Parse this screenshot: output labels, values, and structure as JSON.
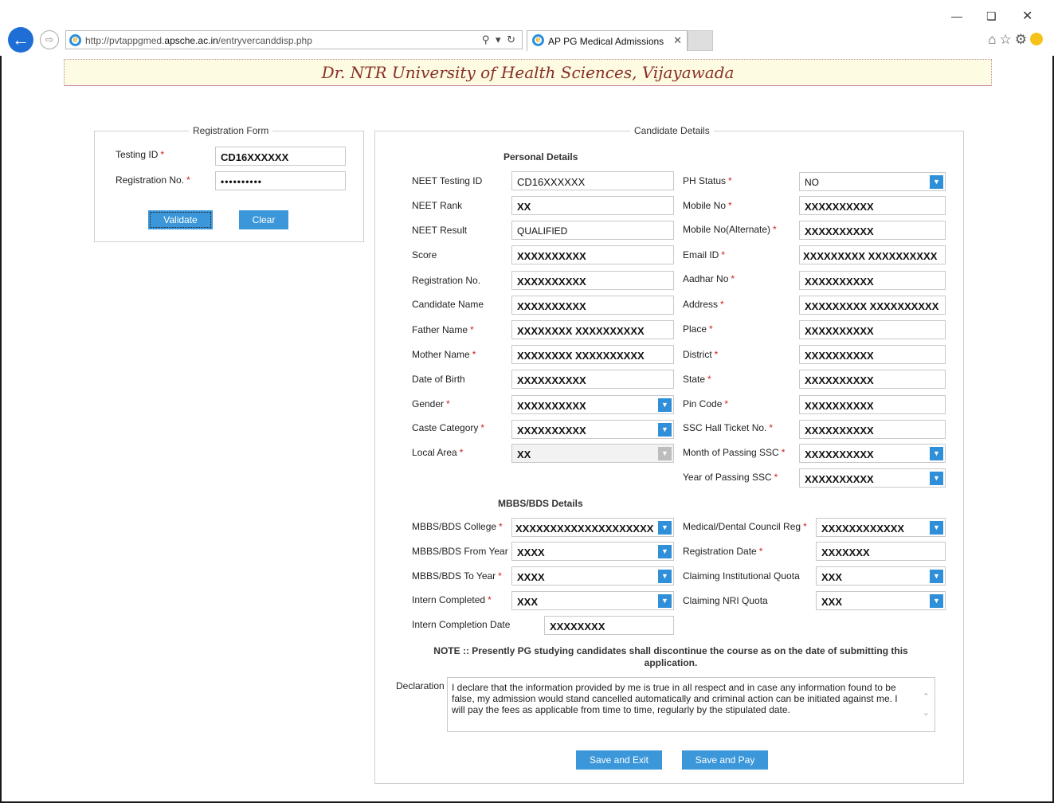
{
  "browser": {
    "url_prefix": "http://pvtappgmed.",
    "url_domain": "apsche.ac.in",
    "url_path": "/entryvercanddisp.php",
    "tab_title": "AP PG Medical Admissions"
  },
  "page": {
    "banner": "Dr. NTR University of Health Sciences, Vijayawada"
  },
  "registration": {
    "legend": "Registration Form",
    "testing_id_label": "Testing ID",
    "testing_id_value": "CD16XXXXXX",
    "reg_no_label": "Registration No.",
    "reg_no_value": "••••••••••",
    "validate_label": "Validate",
    "clear_label": "Clear"
  },
  "candidate": {
    "legend": "Candidate Details",
    "personal_heading": "Personal Details",
    "left_fields": [
      {
        "label": "NEET Testing ID",
        "value": "CD16XXXXXX",
        "required": false
      },
      {
        "label": "NEET Rank",
        "value": "XX",
        "required": false
      },
      {
        "label": "NEET Result",
        "value": "QUALIFIED",
        "required": false
      },
      {
        "label": "Score",
        "value": "XXXXXXXXXX",
        "required": false
      },
      {
        "label": "Registration No.",
        "value": "XXXXXXXXXX",
        "required": false
      },
      {
        "label": "Candidate Name",
        "value": "XXXXXXXXXX",
        "required": false
      },
      {
        "label": "Father Name",
        "value": "XXXXXXXX XXXXXXXXXX",
        "required": true
      },
      {
        "label": "Mother Name",
        "value": "XXXXXXXX XXXXXXXXXX",
        "required": true
      },
      {
        "label": "Date of Birth",
        "value": "XXXXXXXXXX",
        "required": false
      },
      {
        "label": "Gender",
        "value": "XXXXXXXXXX",
        "required": true
      },
      {
        "label": "Caste Category",
        "value": "XXXXXXXXXX",
        "required": true
      },
      {
        "label": "Local Area",
        "value": "XX",
        "required": true
      }
    ],
    "right_fields": [
      {
        "label": "PH Status",
        "value": "NO",
        "required": true
      },
      {
        "label": "Mobile No",
        "value": "XXXXXXXXXX",
        "required": true
      },
      {
        "label": "Mobile No(Alternate)",
        "value": "XXXXXXXXXX",
        "required": true
      },
      {
        "label": "Email ID",
        "value": "XXXXXXXXX XXXXXXXXXX",
        "required": true
      },
      {
        "label": "Aadhar No",
        "value": "XXXXXXXXXX",
        "required": true
      },
      {
        "label": "Address",
        "value": "XXXXXXXXX XXXXXXXXXX",
        "required": true
      },
      {
        "label": "Place",
        "value": "XXXXXXXXXX",
        "required": true
      },
      {
        "label": "District",
        "value": "XXXXXXXXXX",
        "required": true
      },
      {
        "label": "State",
        "value": "XXXXXXXXXX",
        "required": true
      },
      {
        "label": "Pin Code",
        "value": "XXXXXXXXXX",
        "required": true
      },
      {
        "label": "SSC Hall Ticket No.",
        "value": "XXXXXXXXXX",
        "required": true
      },
      {
        "label": "Month of Passing SSC",
        "value": "XXXXXXXXXX",
        "required": true
      },
      {
        "label": "Year of Passing SSC",
        "value": "XXXXXXXXXX",
        "required": true
      }
    ],
    "mbbs_heading": "MBBS/BDS Details",
    "mbbs_left": [
      {
        "label": "MBBS/BDS College",
        "value": "XXXXXXXXXXXXXXXXXXXX",
        "required": true
      },
      {
        "label": "MBBS/BDS From Year",
        "value": "XXXX",
        "required": false
      },
      {
        "label": "MBBS/BDS To Year",
        "value": "XXXX",
        "required": true
      },
      {
        "label": "Intern Completed",
        "value": "XXX",
        "required": true
      },
      {
        "label": "Intern Completion Date",
        "value": "XXXXXXXX",
        "required": false
      }
    ],
    "mbbs_right": [
      {
        "label": "Medical/Dental Council Reg",
        "value": "XXXXXXXXXXXX",
        "required": true
      },
      {
        "label": "Registration Date",
        "value": "XXXXXXX",
        "required": true
      },
      {
        "label": "Claiming Institutional Quota",
        "value": "XXX",
        "required": false
      },
      {
        "label": "Claiming NRI Quota",
        "value": "XXX",
        "required": false
      }
    ],
    "note": "NOTE :: Presently PG studying candidates shall discontinue the course as on the date of submitting this application.",
    "declaration_label": "Declaration",
    "declaration_text": "I declare that the information provided by me is true in all respect and in case any information found to be false, my admission would stand cancelled automatically and criminal action can be initiated against me. I will pay the fees as applicable from time to time, regularly by the stipulated date.",
    "save_exit_label": "Save and Exit",
    "save_pay_label": "Save and Pay"
  },
  "colors": {
    "accent": "#3b97d9",
    "banner_bg": "#fdfbe2",
    "banner_text": "#8a3028",
    "required": "#d12020"
  }
}
